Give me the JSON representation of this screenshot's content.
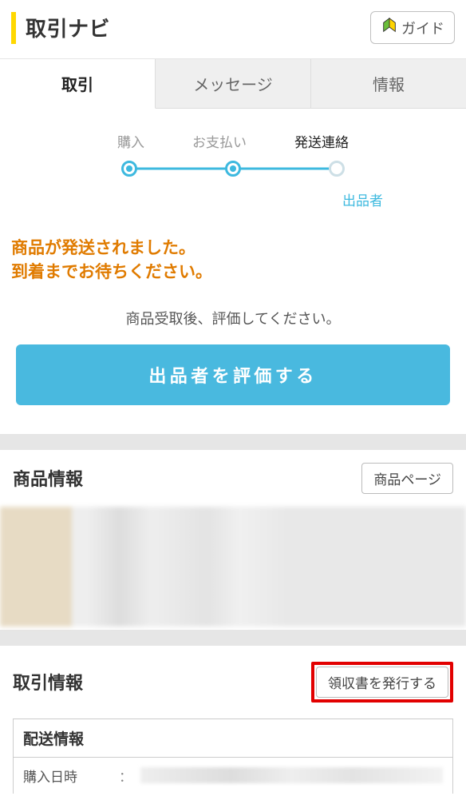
{
  "header": {
    "title": "取引ナビ",
    "guide_label": "ガイド"
  },
  "tabs": {
    "items": [
      {
        "label": "取引",
        "active": true
      },
      {
        "label": "メッセージ",
        "active": false
      },
      {
        "label": "情報",
        "active": false
      }
    ]
  },
  "progress": {
    "steps": [
      {
        "label": "購入",
        "state": "done"
      },
      {
        "label": "お支払い",
        "state": "done"
      },
      {
        "label": "発送連絡",
        "state": "current"
      }
    ],
    "sub_label": "出品者"
  },
  "status": {
    "line1": "商品が発送されました。",
    "line2": "到着までお待ちください。",
    "sub": "商品受取後、評価してください。"
  },
  "main_action": {
    "label": "出品者を評価する"
  },
  "product_section": {
    "title": "商品情報",
    "page_button": "商品ページ"
  },
  "transaction_section": {
    "title": "取引情報",
    "receipt_button": "領収書を発行する"
  },
  "shipping": {
    "title": "配送情報",
    "rows": [
      {
        "label": "購入日時"
      }
    ]
  },
  "colors": {
    "accent_blue": "#49b9df",
    "accent_orange": "#e07b00",
    "highlight_red": "#e20000",
    "yellow_bar": "#ffd800"
  }
}
